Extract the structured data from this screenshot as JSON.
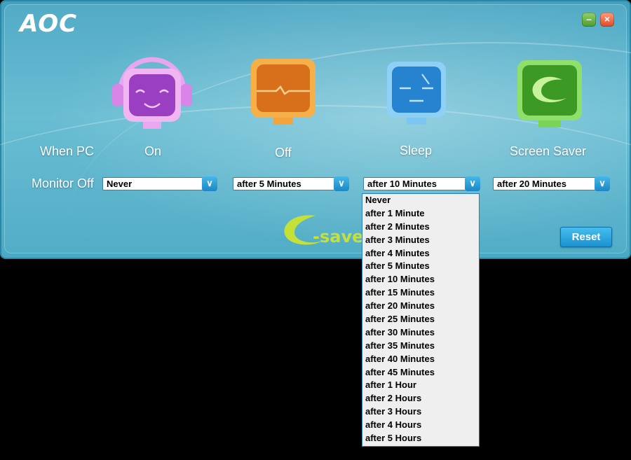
{
  "app": {
    "logo": "AOC"
  },
  "window_controls": {
    "minimize": "–",
    "close": "×"
  },
  "modes": [
    {
      "label": "On",
      "icon": "headphones-face-icon",
      "color": "#b05ad0"
    },
    {
      "label": "Off",
      "icon": "off-monitor-icon",
      "color": "#e98a1f"
    },
    {
      "label": "Sleep",
      "icon": "sleep-face-icon",
      "color": "#2e8fd6"
    },
    {
      "label": "Screen Saver",
      "icon": "screensaver-logo-icon",
      "color": "#4fb32c"
    }
  ],
  "row_labels": {
    "when_pc": "When PC",
    "monitor_off": "Monitor Off"
  },
  "selects": [
    {
      "value": "Never"
    },
    {
      "value": "after 5 Minutes"
    },
    {
      "value": "after 10 Minutes"
    },
    {
      "value": "after 20 Minutes"
    }
  ],
  "brand": {
    "esaver": "-saver"
  },
  "reset_label": "Reset",
  "dropdown_options": [
    "Never",
    "after 1 Minute",
    "after 2 Minutes",
    "after 3 Minutes",
    "after 4 Minutes",
    "after 5 Minutes",
    "after 10 Minutes",
    "after 15 Minutes",
    "after 20 Minutes",
    "after 25 Minutes",
    "after 30 Minutes",
    "after 35 Minutes",
    "after 40 Minutes",
    "after 45 Minutes",
    "after 1 Hour",
    "after 2 Hours",
    "after 3 Hours",
    "after 4 Hours",
    "after 5 Hours"
  ]
}
